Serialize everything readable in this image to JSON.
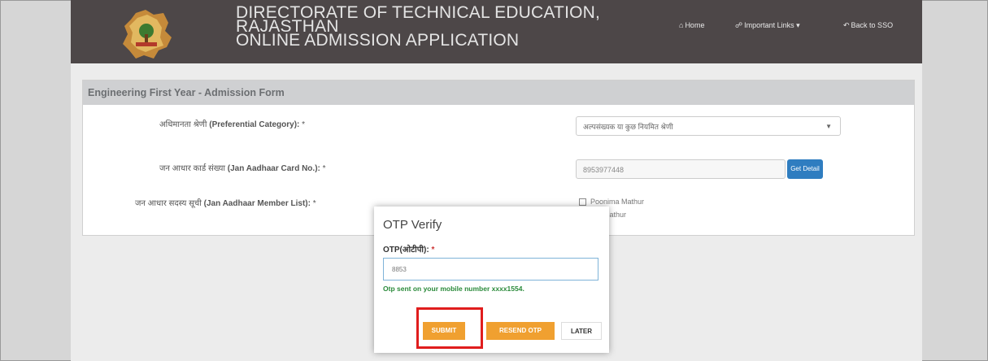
{
  "header": {
    "title_lines": [
      "DIRECTORATE OF TECHNICAL EDUCATION,",
      "RAJASTHAN",
      "ONLINE ADMISSION APPLICATION"
    ],
    "nav": [
      {
        "icon": "home-icon",
        "label": "Home"
      },
      {
        "icon": "link-icon",
        "label": "Important Links"
      },
      {
        "icon": "back-icon",
        "label": "Back to SSO"
      }
    ]
  },
  "form": {
    "panel_title": "Engineering First Year - Admission Form",
    "fields": [
      {
        "label_hi": "अधिमानता श्रेणी",
        "label_en": "(Preferential Category):",
        "value": "अल्पसंख्यक या कुछ नियमित श्रेणी"
      },
      {
        "label_hi": "जन आधार कार्ड संख्या",
        "label_en": "(Jan Aadhaar Card No.):",
        "value": "8953977448",
        "button": "Get Detail"
      },
      {
        "label_hi": "जन आधार सदस्य सूची",
        "label_en": "(Jan Aadhaar Member List):"
      }
    ],
    "members": [
      "Poonima Mathur",
      "Mathur"
    ]
  },
  "modal": {
    "title": "OTP Verify",
    "otp_label": "OTP(ओटीपी):",
    "otp_value": "8853",
    "message": "Otp sent on your mobile number xxxx1554.",
    "submit_label": "SUBMIT",
    "resend_label": "RESEND OTP",
    "later_label": "LATER"
  },
  "colors": {
    "topbar": "#4d4748",
    "accent_orange": "#f0a030",
    "button_blue": "#2f7dc0",
    "highlight_red": "#e01d1d"
  }
}
